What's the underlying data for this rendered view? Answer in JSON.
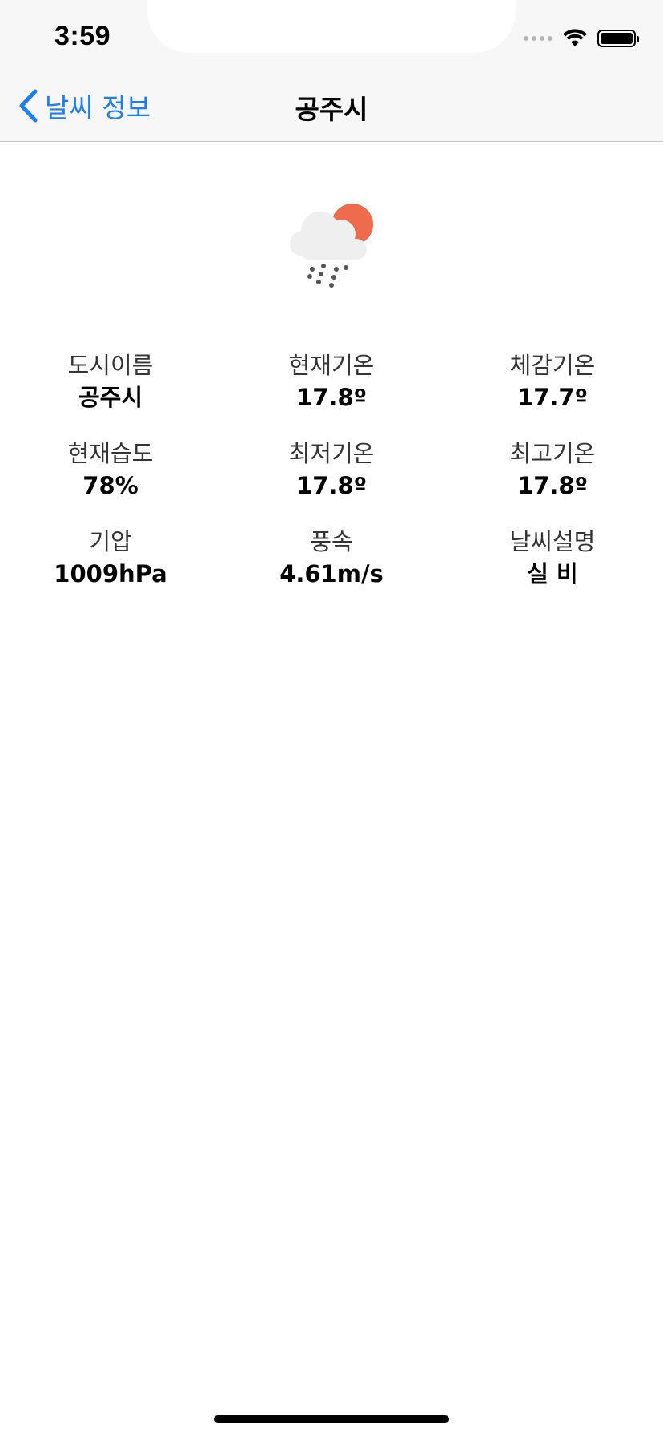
{
  "status_bar": {
    "time": "3:59"
  },
  "nav": {
    "back_label": "날씨 정보",
    "title": "공주시"
  },
  "weather_icon": {
    "name": "sun-cloud-rain-icon",
    "sun_color": "#ef6b4e",
    "cloud_color": "#efefef",
    "rain_color": "#555555"
  },
  "info": [
    {
      "label": "도시이름",
      "value": "공주시"
    },
    {
      "label": "현재기온",
      "value": "17.8º"
    },
    {
      "label": "체감기온",
      "value": "17.7º"
    },
    {
      "label": "현재습도",
      "value": "78%"
    },
    {
      "label": "최저기온",
      "value": "17.8º"
    },
    {
      "label": "최고기온",
      "value": "17.8º"
    },
    {
      "label": "기압",
      "value": "1009hPa"
    },
    {
      "label": "풍속",
      "value": "4.61m/s"
    },
    {
      "label": "날씨설명",
      "value": "실 비"
    }
  ],
  "colors": {
    "accent": "#1a7ef6",
    "nav_background": "#f7f7f7"
  }
}
